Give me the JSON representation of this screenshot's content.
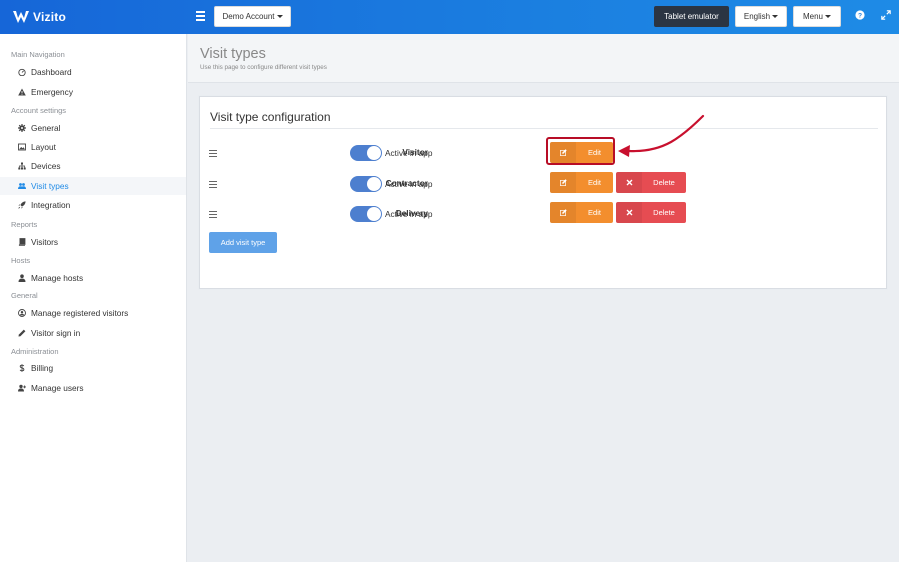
{
  "brand": {
    "name": "Vizito"
  },
  "topbar": {
    "account_label": "Demo Account",
    "tablet_label": "Tablet emulator",
    "language_label": "English",
    "menu_label": "Menu",
    "help_icon": "question-circle-icon",
    "expand_icon": "expand-icon"
  },
  "sidebar": {
    "sections": [
      {
        "title": "Main Navigation",
        "items": [
          {
            "label": "Dashboard",
            "icon": "dashboard-icon"
          },
          {
            "label": "Emergency",
            "icon": "warning-icon"
          }
        ]
      },
      {
        "title": "Account settings",
        "items": [
          {
            "label": "General",
            "icon": "gear-icon"
          },
          {
            "label": "Layout",
            "icon": "image-icon"
          },
          {
            "label": "Devices",
            "icon": "sitemap-icon"
          },
          {
            "label": "Visit types",
            "icon": "users-icon",
            "active": true
          },
          {
            "label": "Integration",
            "icon": "rocket-icon"
          }
        ]
      },
      {
        "title": "Reports",
        "items": [
          {
            "label": "Visitors",
            "icon": "book-icon"
          }
        ]
      },
      {
        "title": "Hosts",
        "items": [
          {
            "label": "Manage hosts",
            "icon": "user-icon"
          }
        ]
      },
      {
        "title": "General",
        "items": [
          {
            "label": "Manage registered visitors",
            "icon": "user-circle-icon"
          },
          {
            "label": "Visitor sign in",
            "icon": "pencil-icon"
          }
        ]
      },
      {
        "title": "Administration",
        "items": [
          {
            "label": "Billing",
            "icon": "dollar-icon"
          },
          {
            "label": "Manage users",
            "icon": "user-plus-icon"
          }
        ]
      }
    ]
  },
  "page": {
    "title": "Visit types",
    "subtitle": "Use this page to configure different visit types"
  },
  "panel": {
    "title": "Visit type configuration",
    "toggle_label": "Active in app",
    "edit_label": "Edit",
    "delete_label": "Delete",
    "add_label": "Add visit type",
    "rows": [
      {
        "name": "Visitor",
        "active": true,
        "deletable": false
      },
      {
        "name": "Contractor",
        "active": true,
        "deletable": true
      },
      {
        "name": "Delivery",
        "active": true,
        "deletable": true
      }
    ]
  },
  "colors": {
    "topbar": "#1b7fe0",
    "accent": "#1f8ae6",
    "edit": "#f38e2e",
    "delete": "#e64c52",
    "highlight": "#b80d26",
    "toggle": "#4d7fcf"
  }
}
